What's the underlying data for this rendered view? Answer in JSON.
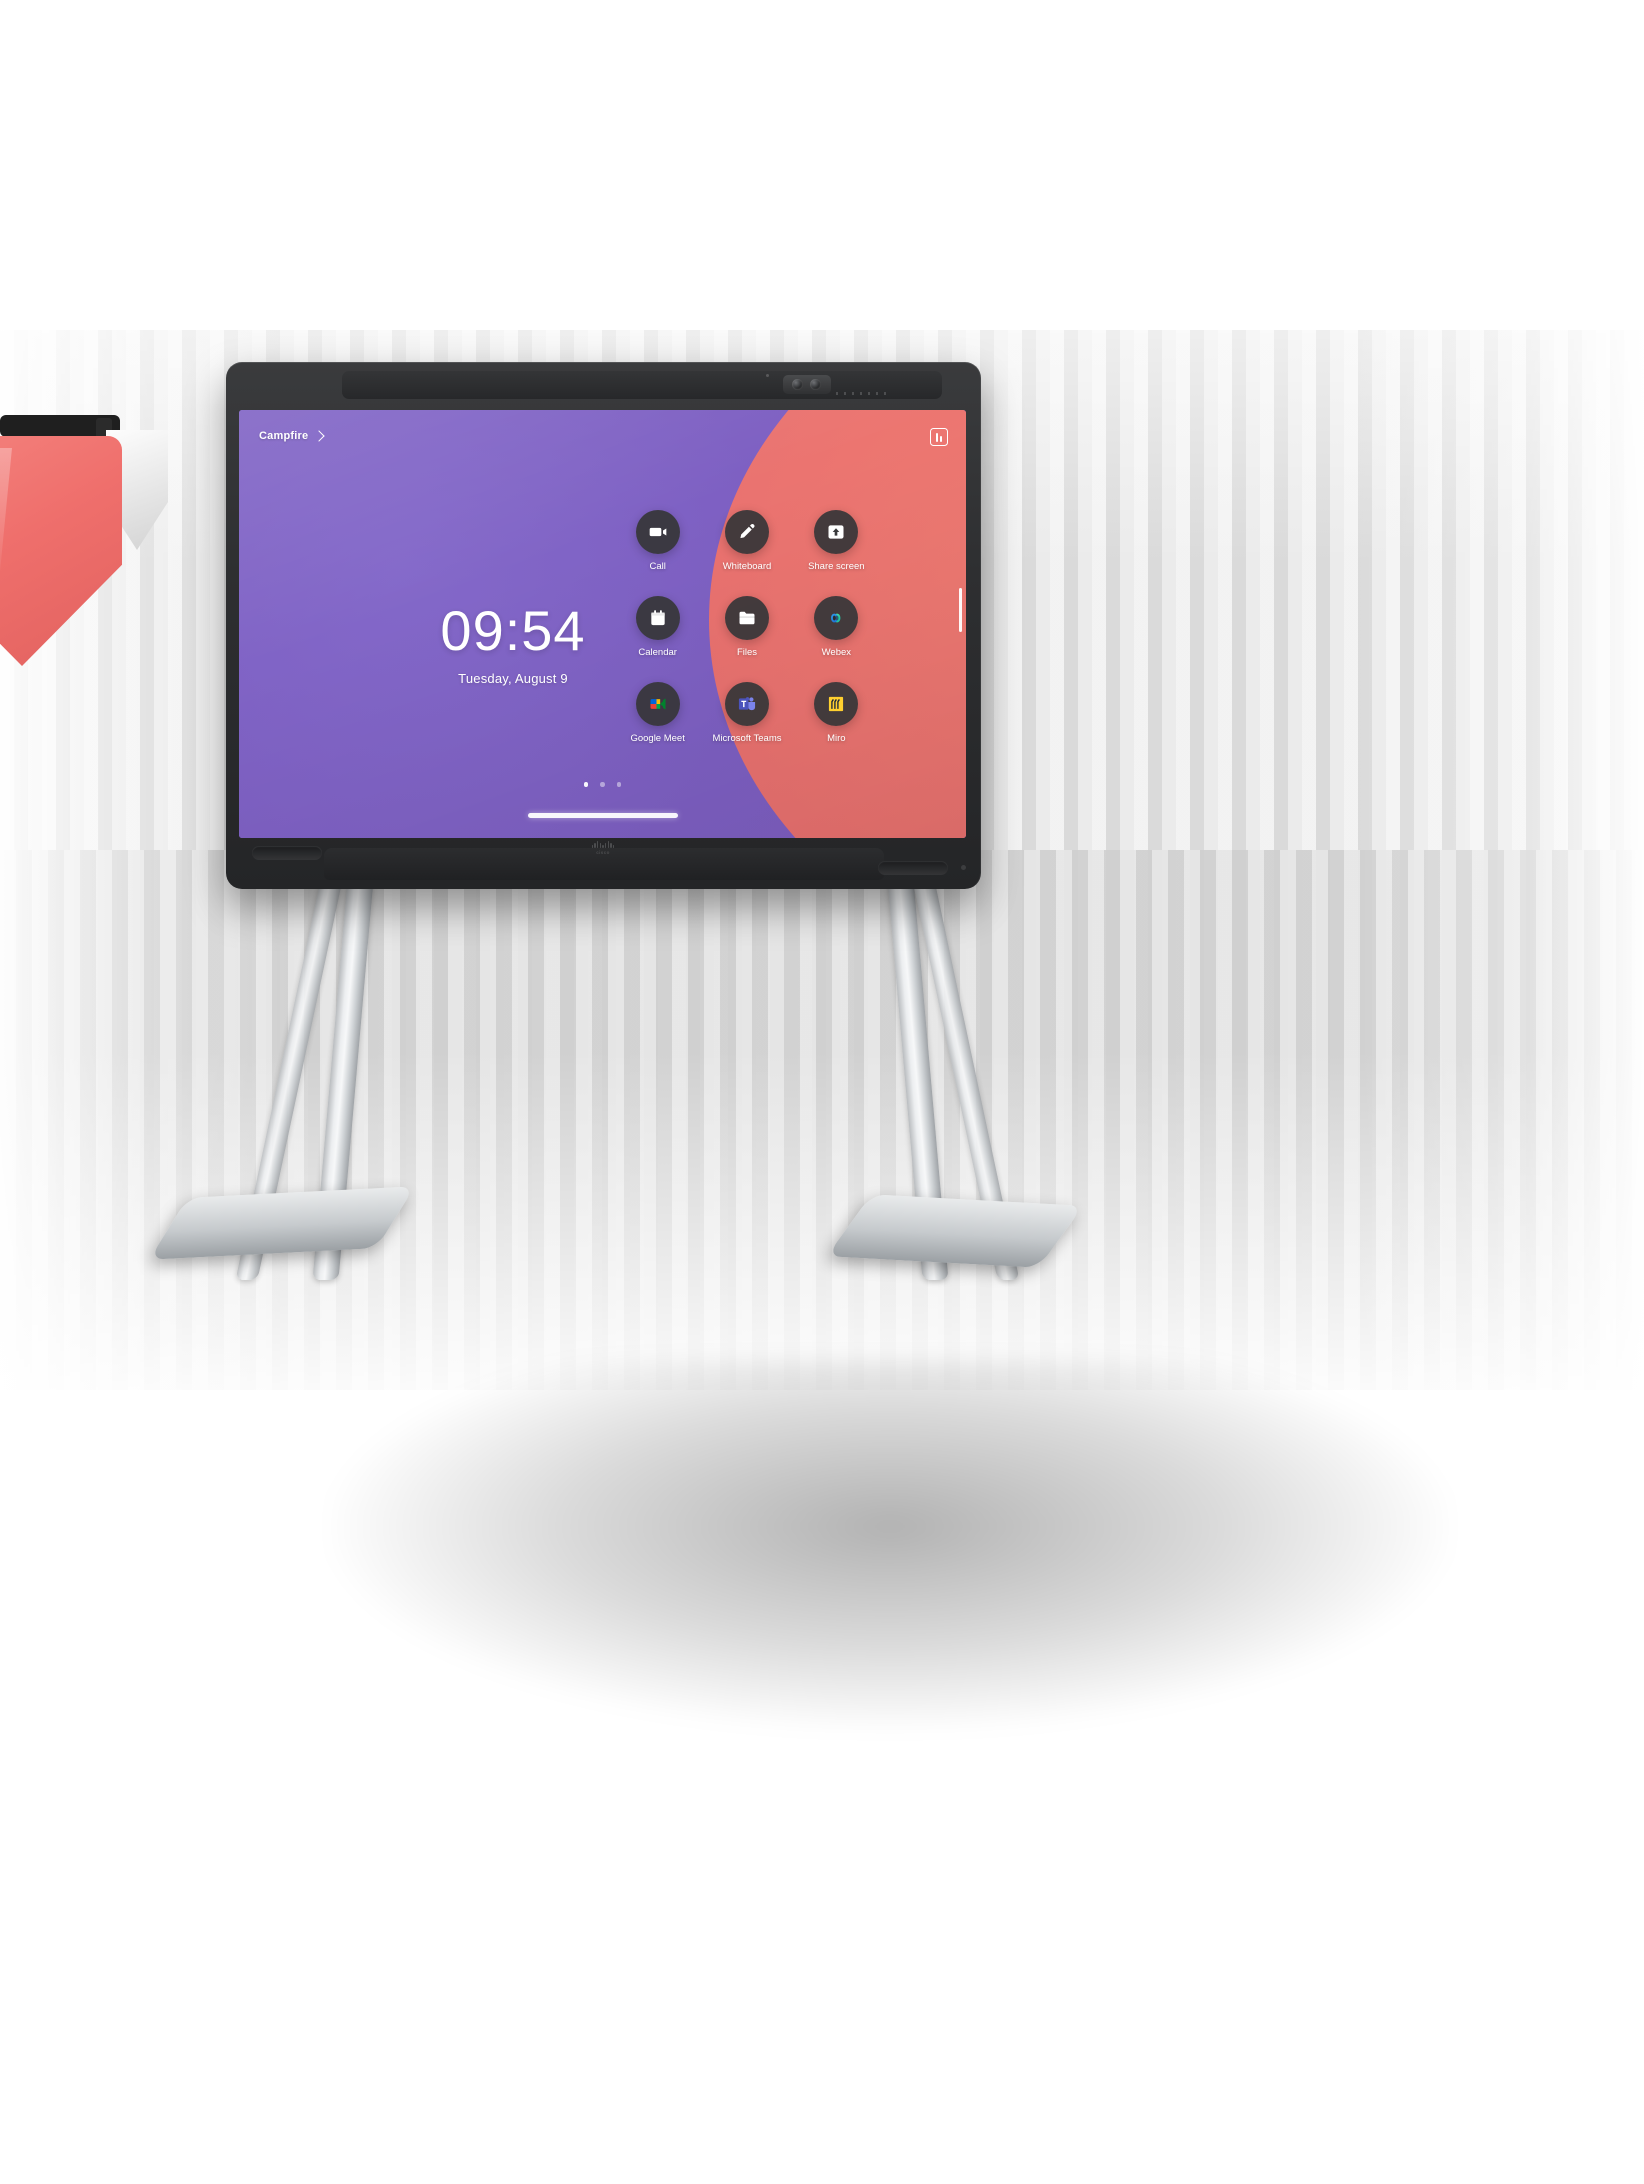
{
  "device": {
    "name": "cisco-board-pro",
    "brand_label": "cisco",
    "bezel_color": "#2e2f31"
  },
  "screen": {
    "room_name": "Campfire",
    "settings_icon": "sliders-icon",
    "wallpaper_colors": [
      "#7b5ec0",
      "#8163c7",
      "#b05fa8",
      "#e2696f"
    ],
    "clock": {
      "time": "09:54",
      "date": "Tuesday, August 9"
    },
    "apps": [
      {
        "label": "Call",
        "icon": "video-camera-icon"
      },
      {
        "label": "Whiteboard",
        "icon": "pen-icon"
      },
      {
        "label": "Share screen",
        "icon": "share-screen-icon"
      },
      {
        "label": "Calendar",
        "icon": "calendar-icon"
      },
      {
        "label": "Files",
        "icon": "folder-icon"
      },
      {
        "label": "Webex",
        "icon": "webex-icon"
      },
      {
        "label": "Google Meet",
        "icon": "google-meet-icon"
      },
      {
        "label": "Microsoft Teams",
        "icon": "microsoft-teams-icon"
      },
      {
        "label": "Miro",
        "icon": "miro-icon"
      }
    ],
    "page_dots": {
      "count": 3,
      "active_index": 0
    }
  }
}
